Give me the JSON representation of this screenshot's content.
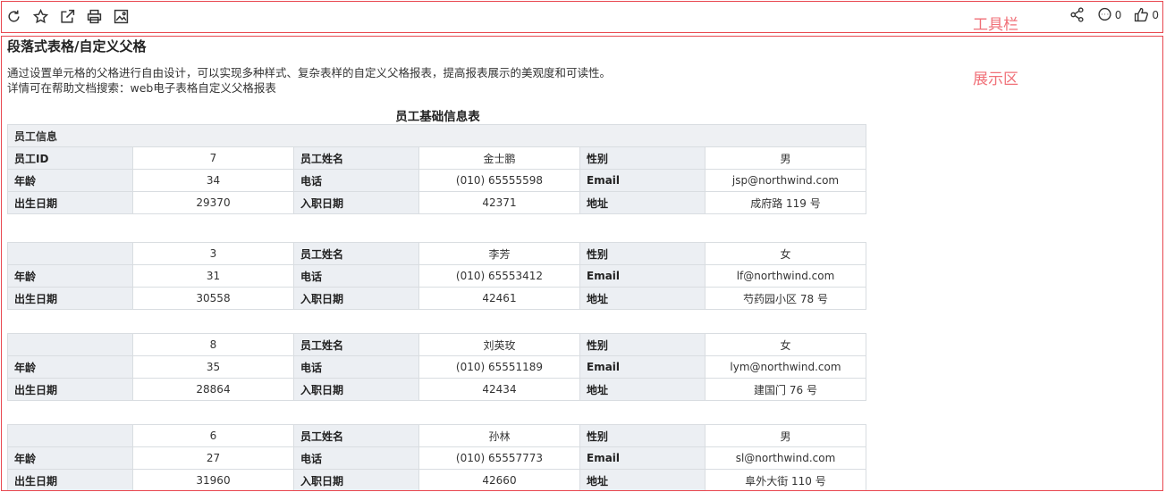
{
  "toolbar": {
    "icons": [
      "refresh-icon",
      "star-icon",
      "external-link-icon",
      "print-icon",
      "image-export-icon"
    ],
    "annotation": "工具栏",
    "comment_count": "0",
    "like_count": "0"
  },
  "display_annotation": "展示区",
  "page": {
    "title": "段落式表格/自定义父格",
    "desc_line1": "通过设置单元格的父格进行自由设计，可以实现多种样式、复杂表样的自定义父格报表，提高报表展示的美观度和可读性。",
    "desc_line2": "详情可在帮助文档搜索：web电子表格自定义父格报表"
  },
  "report": {
    "title": "员工基础信息表",
    "section": "员工信息",
    "labels": {
      "id": "员工ID",
      "name": "员工姓名",
      "gender": "性别",
      "age": "年龄",
      "phone": "电话",
      "email": "Email",
      "birth": "出生日期",
      "hire": "入职日期",
      "address": "地址"
    },
    "employees": [
      {
        "id": "7",
        "name": "金士鹏",
        "gender": "男",
        "age": "34",
        "phone": "(010) 65555598",
        "email": "jsp@northwind.com",
        "birth": "29370",
        "hire": "42371",
        "address": "成府路 119 号"
      },
      {
        "id": "3",
        "name": "李芳",
        "gender": "女",
        "age": "31",
        "phone": "(010) 65553412",
        "email": "lf@northwind.com",
        "birth": "30558",
        "hire": "42461",
        "address": "芍药园小区 78 号"
      },
      {
        "id": "8",
        "name": "刘英玫",
        "gender": "女",
        "age": "35",
        "phone": "(010) 65551189",
        "email": "lym@northwind.com",
        "birth": "28864",
        "hire": "42434",
        "address": "建国门 76 号"
      },
      {
        "id": "6",
        "name": "孙林",
        "gender": "男",
        "age": "27",
        "phone": "(010) 65557773",
        "email": "sl@northwind.com",
        "birth": "31960",
        "hire": "42660",
        "address": "阜外大街 110 号"
      }
    ]
  }
}
